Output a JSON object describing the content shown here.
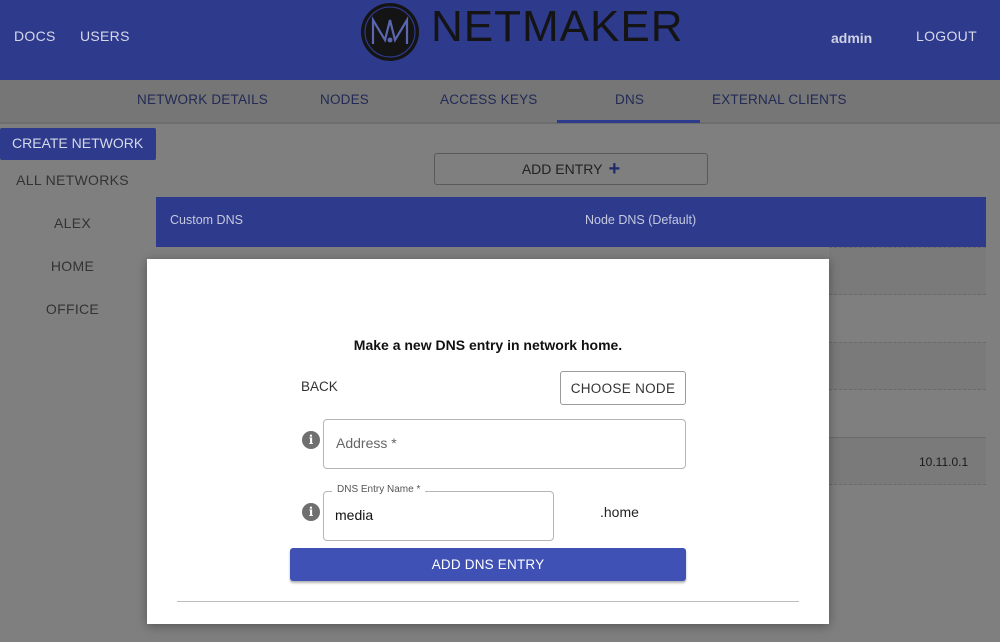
{
  "header": {
    "nav": [
      "DOCS",
      "USERS"
    ],
    "brand": "NETMAKER",
    "user": "admin",
    "logout_label": "LOGOUT"
  },
  "tabs": [
    {
      "label": "NETWORK DETAILS"
    },
    {
      "label": "NODES"
    },
    {
      "label": "ACCESS KEYS"
    },
    {
      "label": "DNS",
      "active": true
    },
    {
      "label": "EXTERNAL CLIENTS"
    }
  ],
  "sidebar": {
    "create_label": "CREATE NETWORK",
    "items": [
      "ALL NETWORKS",
      "ALEX",
      "HOME",
      "OFFICE"
    ]
  },
  "dns_page": {
    "add_entry_label": "ADD ENTRY",
    "add_entry_icon": "plus-icon",
    "columns": [
      "Custom DNS",
      "Node DNS (Default)"
    ],
    "visible_address": "10.11.0.1"
  },
  "modal": {
    "title": "Make a new DNS entry in network home.",
    "back_label": "BACK",
    "choose_node_label": "CHOOSE NODE",
    "address_placeholder": "Address *",
    "dns_name_label": "DNS Entry Name *",
    "dns_name_value": "media",
    "domain_suffix": ".home",
    "submit_label": "ADD DNS ENTRY",
    "info_icon": "info-icon"
  },
  "colors": {
    "primary": "#2e3a8c",
    "button": "#3f51b5",
    "overlay": "#7f7f7f"
  }
}
